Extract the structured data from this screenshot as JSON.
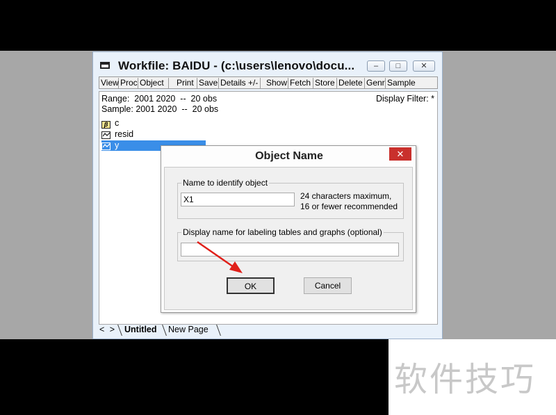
{
  "window": {
    "title": "Workfile: BAIDU - (c:\\users\\lenovo\\docu...",
    "controls": {
      "minimize": "‒",
      "maximize": "□",
      "close": "✕"
    }
  },
  "toolbar": {
    "buttons": [
      "View",
      "Proc",
      "Object",
      "Print",
      "Save",
      "Details +/-",
      "Show",
      "Fetch",
      "Store",
      "Delete",
      "Genr",
      "Sample"
    ]
  },
  "info": {
    "range": "Range:  2001 2020  --  20 obs",
    "sample": "Sample: 2001 2020  --  20 obs",
    "display_filter": "Display Filter: *"
  },
  "objects": [
    {
      "name": "c",
      "icon": "coef-vector-icon",
      "glyph": "β"
    },
    {
      "name": "resid",
      "icon": "series-icon",
      "glyph": ""
    },
    {
      "name": "y",
      "icon": "series-icon",
      "glyph": "",
      "selected": true
    }
  ],
  "tabs": {
    "arrows": "< >",
    "active": "Untitled",
    "new_page": "New Page"
  },
  "dialog": {
    "title": "Object Name",
    "close": "✕",
    "name_group_label": "Name to identify object",
    "name_value": "X1",
    "name_hint": "24 characters maximum, 16 or fewer recommended",
    "display_group_label": "Display name for labeling tables and graphs  (optional)",
    "display_value": "",
    "ok_label": "OK",
    "cancel_label": "Cancel",
    "arrow_color": "#e0201a"
  },
  "watermark": {
    "text": "软件技巧"
  }
}
